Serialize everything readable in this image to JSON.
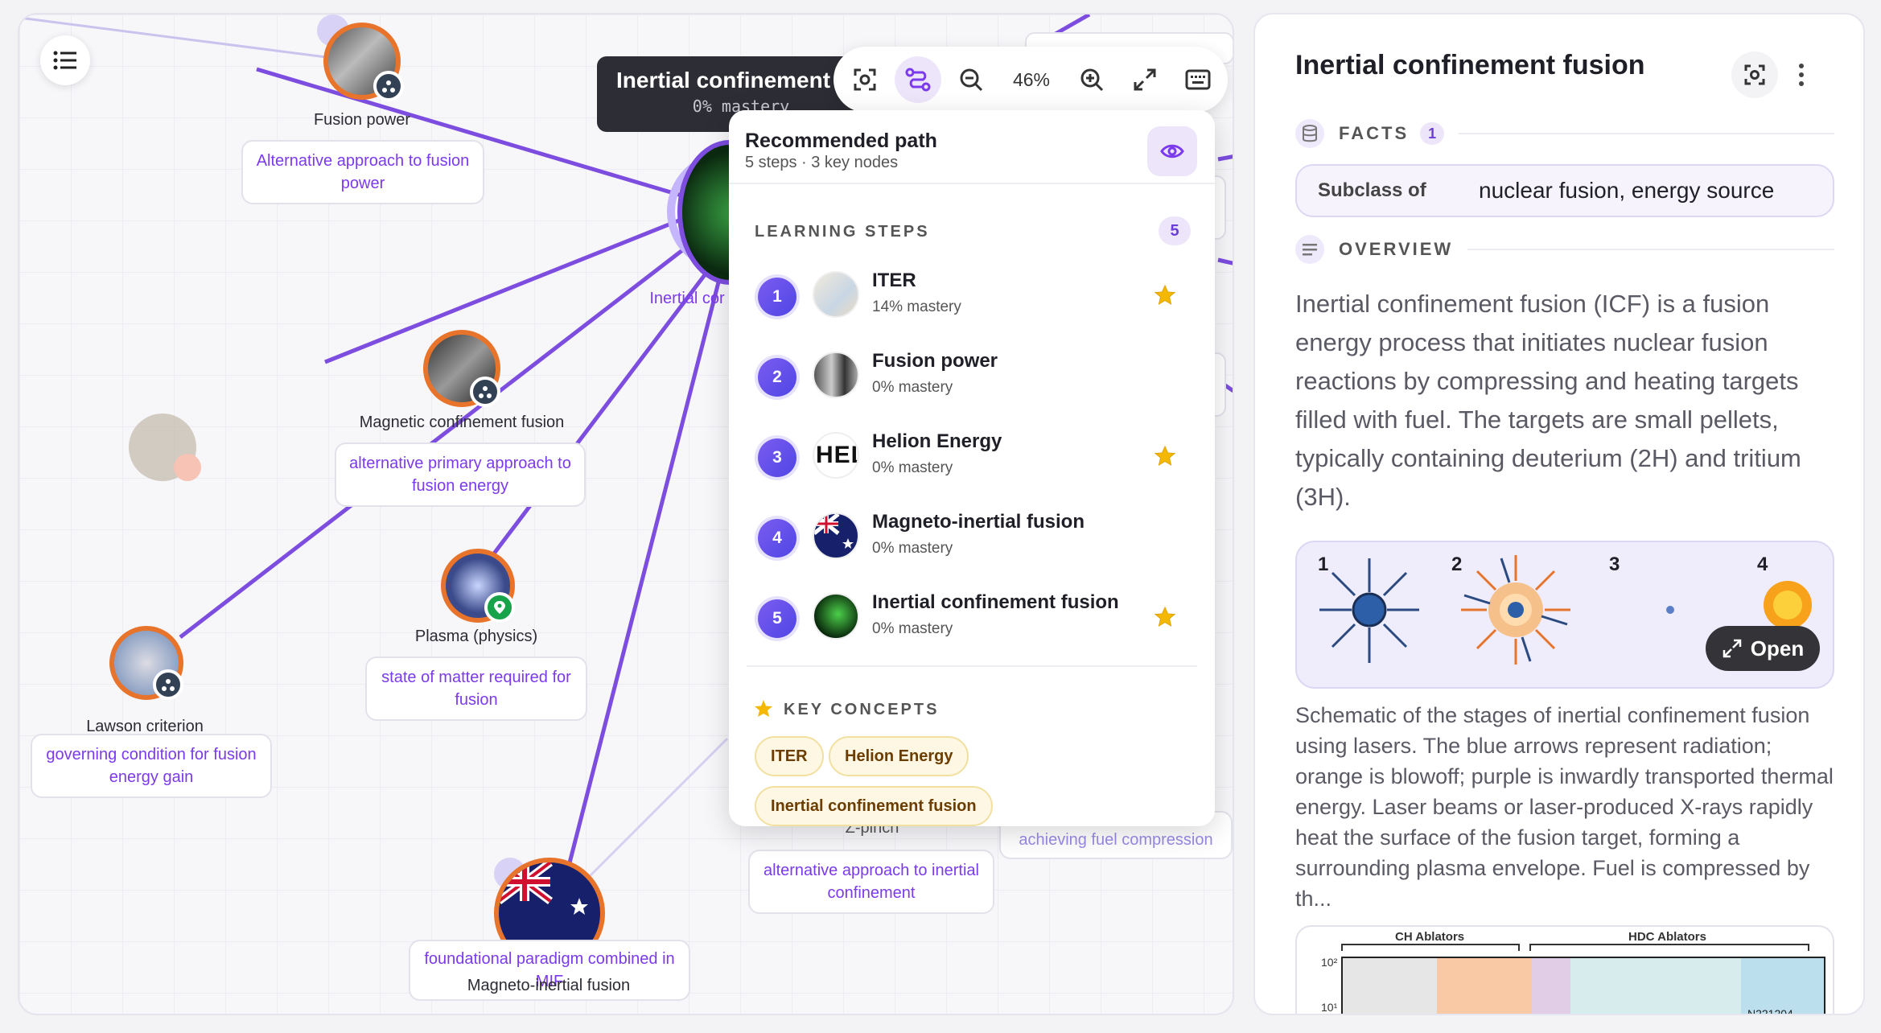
{
  "graph": {
    "tooltip": {
      "title": "Inertial confinement fusion",
      "mastery": "0% mastery"
    },
    "toolbar": {
      "zoom": "46%"
    },
    "nodes": {
      "fusion_power": "Fusion power",
      "magnetic": "Magnetic confinement fusion",
      "plasma": "Plasma (physics)",
      "lawson": "Lawson criterion",
      "center": "Inertial cor",
      "magneto": "Magneto-inertial fusion",
      "zpinch": "Z-pinch"
    },
    "edge_labels": {
      "fusion_power": "Alternative approach to fusion power",
      "magnetic": "alternative primary approach to fusion energy",
      "plasma": "state of matter required for fusion",
      "lawson": "governing condition for fusion energy gain",
      "magneto": "foundational paradigm combined in MIF",
      "zpinch": "alternative approach to inertial confinement",
      "right_clip": "achieving fuel compression"
    }
  },
  "path": {
    "title": "Recommended path",
    "subtitle": "5 steps · 3 key nodes",
    "steps_heading": "LEARNING STEPS",
    "steps_count": "5",
    "steps": [
      {
        "num": "1",
        "name": "ITER",
        "mastery": "14% mastery",
        "key": true
      },
      {
        "num": "2",
        "name": "Fusion power",
        "mastery": "0% mastery",
        "key": false
      },
      {
        "num": "3",
        "name": "Helion Energy",
        "mastery": "0% mastery",
        "key": true
      },
      {
        "num": "4",
        "name": "Magneto-inertial fusion",
        "mastery": "0% mastery",
        "key": false
      },
      {
        "num": "5",
        "name": "Inertial confinement fusion",
        "mastery": "0% mastery",
        "key": true
      }
    ],
    "concepts_heading": "KEY CONCEPTS",
    "concepts": [
      "ITER",
      "Helion Energy",
      "Inertial confinement fusion"
    ],
    "helion_logo_text": "HEL"
  },
  "detail": {
    "title": "Inertial confinement fusion",
    "facts_heading": "FACTS",
    "facts_count": "1",
    "fact_key": "Subclass of",
    "fact_value": "nuclear fusion, energy source",
    "overview_heading": "OVERVIEW",
    "overview": "Inertial confinement fusion (ICF) is a fusion energy process that initiates nuclear fusion reactions by compressing and heating targets filled with fuel. The targets are small pellets, typically containing deuterium (2H) and tritium (3H).",
    "stages": [
      "1",
      "2",
      "3",
      "4"
    ],
    "open_label": "Open",
    "caption": "Schematic of the stages of inertial confinement fusion using lasers. The blue arrows represent radiation; orange is blowoff; purple is inwardly transported thermal energy. Laser beams or laser-produced X-rays rapidly heat the surface of the fusion target, forming a surrounding plasma envelope. Fuel is compressed by th...",
    "chart_labels": {
      "ch": "CH Ablators",
      "hdc": "HDC Ablators",
      "y1": "10²",
      "y2": "10¹",
      "id": "N221204"
    }
  },
  "colors": {
    "accent": "#7c3aed",
    "node_ring": "#e8742c",
    "edge": "#7c4ddf",
    "star": "#f5b800"
  }
}
